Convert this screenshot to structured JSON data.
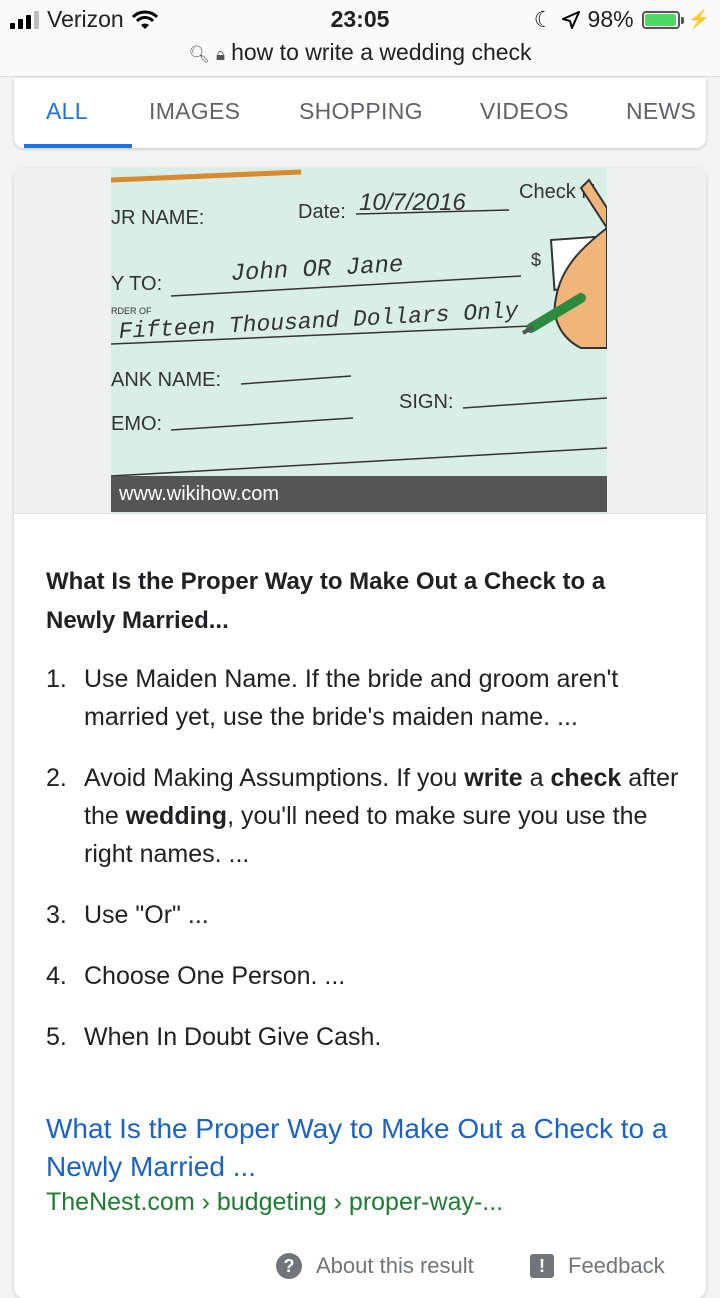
{
  "status_bar": {
    "carrier": "Verizon",
    "time": "23:05",
    "battery": "98%",
    "battery_level": 0.98
  },
  "browser": {
    "url": "how to write a wedding check"
  },
  "search_tabs": [
    {
      "label": "ALL",
      "active": true
    },
    {
      "label": "IMAGES",
      "active": false
    },
    {
      "label": "SHOPPING",
      "active": false
    },
    {
      "label": "VIDEOS",
      "active": false
    },
    {
      "label": "NEWS",
      "active": false
    }
  ],
  "featured_image": {
    "source": "www.wikihow.com",
    "check_text": {
      "date_label": "Date:",
      "date_value": "10/7/2016",
      "check_no": "Check N",
      "your_name": "JR NAME:",
      "pay_to": "Y TO:",
      "payee": "John OR Jane",
      "currency": "$",
      "order_of": "RDER OF",
      "amount_words": "Fifteen Thousand Dollars Only",
      "bank_name": "ANK NAME:",
      "sign": "SIGN:",
      "memo": "EMO:"
    }
  },
  "snippet": {
    "title": "What Is the Proper Way to Make Out a Check to a Newly Married...",
    "steps": [
      {
        "num": "1.",
        "text": "Use Maiden Name. If the bride and groom aren't married yet, use the bride's maiden name. ..."
      },
      {
        "num": "2.",
        "text": "Avoid Making Assumptions. If you write a check after the wedding, you'll need to make sure you use the right names. ..."
      },
      {
        "num": "3.",
        "text": "Use \"Or\" ..."
      },
      {
        "num": "4.",
        "text": "Choose One Person. ..."
      },
      {
        "num": "5.",
        "text": "When In Doubt Give Cash."
      }
    ]
  },
  "result": {
    "link_text": "What Is the Proper Way to Make Out a Check to a Newly Married ...",
    "breadcrumb": "TheNest.com › budgeting › proper-way-..."
  },
  "footer": {
    "about": "About this result",
    "feedback": "Feedback"
  },
  "colors": {
    "link": "#1a62c6",
    "accent": "#1a73e8",
    "breadcrumb": "#1e7c32"
  }
}
